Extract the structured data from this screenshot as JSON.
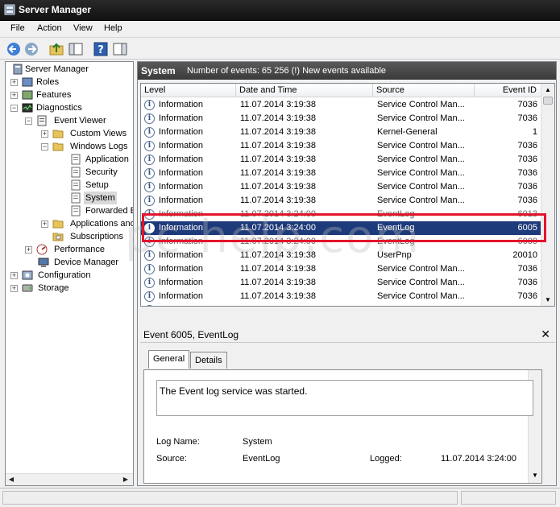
{
  "window": {
    "title": "Server Manager"
  },
  "menu": {
    "file": "File",
    "action": "Action",
    "view": "View",
    "help": "Help"
  },
  "tree": {
    "items": [
      {
        "label": "Server Manager",
        "icon": "server-icon"
      },
      {
        "label": "Roles",
        "icon": "roles-icon"
      },
      {
        "label": "Features",
        "icon": "features-icon"
      },
      {
        "label": "Diagnostics",
        "icon": "diagnostics-icon"
      },
      {
        "label": "Event Viewer",
        "icon": "event-viewer-icon"
      },
      {
        "label": "Custom Views",
        "icon": "folder-icon"
      },
      {
        "label": "Windows Logs",
        "icon": "folder-icon"
      },
      {
        "label": "Application",
        "icon": "log-icon"
      },
      {
        "label": "Security",
        "icon": "log-icon"
      },
      {
        "label": "Setup",
        "icon": "log-icon"
      },
      {
        "label": "System",
        "icon": "log-icon"
      },
      {
        "label": "Forwarded E",
        "icon": "log-icon"
      },
      {
        "label": "Applications and",
        "icon": "folder-icon"
      },
      {
        "label": "Subscriptions",
        "icon": "subscriptions-icon"
      },
      {
        "label": "Performance",
        "icon": "performance-icon"
      },
      {
        "label": "Device Manager",
        "icon": "device-manager-icon"
      },
      {
        "label": "Configuration",
        "icon": "configuration-icon"
      },
      {
        "label": "Storage",
        "icon": "storage-icon"
      }
    ]
  },
  "panel": {
    "title": "System",
    "count": "Number of events: 65 256 (!) New events available"
  },
  "columns": {
    "level": "Level",
    "datetime": "Date and Time",
    "source": "Source",
    "eventid": "Event ID"
  },
  "rows": [
    {
      "level": "Information",
      "datetime": "11.07.2014 3:19:38",
      "source": "Service Control Man...",
      "eventid": "7036"
    },
    {
      "level": "Information",
      "datetime": "11.07.2014 3:19:38",
      "source": "Service Control Man...",
      "eventid": "7036"
    },
    {
      "level": "Information",
      "datetime": "11.07.2014 3:19:38",
      "source": "Kernel-General",
      "eventid": "1"
    },
    {
      "level": "Information",
      "datetime": "11.07.2014 3:19:38",
      "source": "Service Control Man...",
      "eventid": "7036"
    },
    {
      "level": "Information",
      "datetime": "11.07.2014 3:19:38",
      "source": "Service Control Man...",
      "eventid": "7036"
    },
    {
      "level": "Information",
      "datetime": "11.07.2014 3:19:38",
      "source": "Service Control Man...",
      "eventid": "7036"
    },
    {
      "level": "Information",
      "datetime": "11.07.2014 3:19:38",
      "source": "Service Control Man...",
      "eventid": "7036"
    },
    {
      "level": "Information",
      "datetime": "11.07.2014 3:19:38",
      "source": "Service Control Man...",
      "eventid": "7036"
    },
    {
      "level": "Information",
      "datetime": "11.07.2014 3:24:00",
      "source": "EventLog",
      "eventid": "6013"
    },
    {
      "level": "Information",
      "datetime": "11.07.2014 3:24:00",
      "source": "EventLog",
      "eventid": "6005"
    },
    {
      "level": "Information",
      "datetime": "11.07.2014 3:24:00",
      "source": "EventLog",
      "eventid": "6009"
    },
    {
      "level": "Information",
      "datetime": "11.07.2014 3:19:38",
      "source": "UserPnp",
      "eventid": "20010"
    },
    {
      "level": "Information",
      "datetime": "11.07.2014 3:19:38",
      "source": "Service Control Man...",
      "eventid": "7036"
    },
    {
      "level": "Information",
      "datetime": "11.07.2014 3:19:38",
      "source": "Service Control Man...",
      "eventid": "7036"
    },
    {
      "level": "Information",
      "datetime": "11.07.2014 3:19:38",
      "source": "Service Control Man...",
      "eventid": "7036"
    },
    {
      "level": "Information",
      "datetime": "11.07.2014 3:19:38",
      "source": "Service Control Man...",
      "eventid": "7036"
    }
  ],
  "detail": {
    "title": "Event 6005, EventLog",
    "tab_general": "General",
    "tab_details": "Details",
    "message": "The Event log service was started.",
    "log_name_label": "Log Name:",
    "log_name_value": "System",
    "source_label": "Source:",
    "source_value": "EventLog",
    "logged_label": "Logged:",
    "logged_value": "11.07.2014 3:24:00"
  },
  "watermark": "pc-help.com",
  "colors": {
    "titlebar": "#1a1a1a",
    "selection": "#1d3a7a",
    "highlight_box": "#e3142c"
  }
}
